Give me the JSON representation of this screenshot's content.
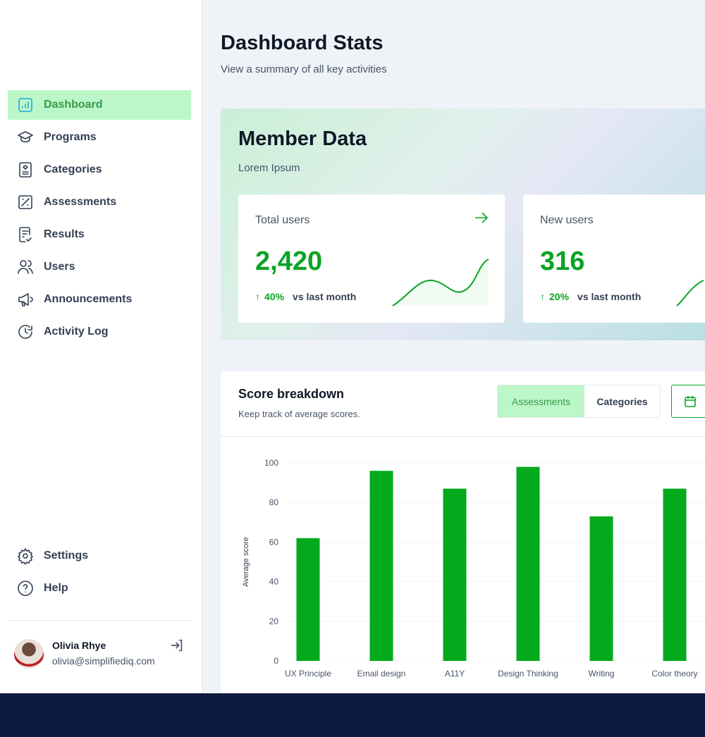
{
  "sidebar": {
    "items": [
      {
        "label": "Dashboard",
        "icon": "dashboard-icon",
        "active": true
      },
      {
        "label": "Programs",
        "icon": "graduation-cap-icon"
      },
      {
        "label": "Categories",
        "icon": "categories-icon"
      },
      {
        "label": "Assessments",
        "icon": "assessment-icon"
      },
      {
        "label": "Results",
        "icon": "results-icon"
      },
      {
        "label": "Users",
        "icon": "users-icon"
      },
      {
        "label": "Announcements",
        "icon": "megaphone-icon"
      },
      {
        "label": "Activity Log",
        "icon": "clock-icon"
      }
    ],
    "bottom": [
      {
        "label": "Settings",
        "icon": "gear-icon"
      },
      {
        "label": "Help",
        "icon": "help-icon"
      }
    ],
    "user": {
      "name": "Olivia Rhye",
      "email": "olivia@simplifiediq.com"
    }
  },
  "header": {
    "title": "Dashboard Stats",
    "subtitle": "View a summary of all key activities"
  },
  "member": {
    "title": "Member Data",
    "subtitle": "Lorem Ipsum",
    "stats": [
      {
        "label": "Total users",
        "value": "2,420",
        "change": "40%",
        "compare": "vs last month"
      },
      {
        "label": "New users",
        "value": "316",
        "change": "20%",
        "compare": "vs last month"
      }
    ]
  },
  "score": {
    "title": "Score breakdown",
    "subtitle": "Keep track of average scores.",
    "tabs": [
      "Assessments",
      "Categories"
    ],
    "active_tab": "Assessments"
  },
  "colors": {
    "accent": "#0aa324",
    "active_bg": "#bbf7c8",
    "footer": "#0c1a3d"
  },
  "chart_data": {
    "type": "bar",
    "categories": [
      "UX Principle",
      "Email design",
      "A11Y",
      "Design Thinking",
      "Writing",
      "Color theory"
    ],
    "values": [
      62,
      96,
      87,
      98,
      73,
      87
    ],
    "ylabel": "Average score",
    "ylim": [
      0,
      100
    ],
    "yticks": [
      "0",
      "20",
      "40",
      "60",
      "80",
      "100"
    ],
    "grid": true
  }
}
